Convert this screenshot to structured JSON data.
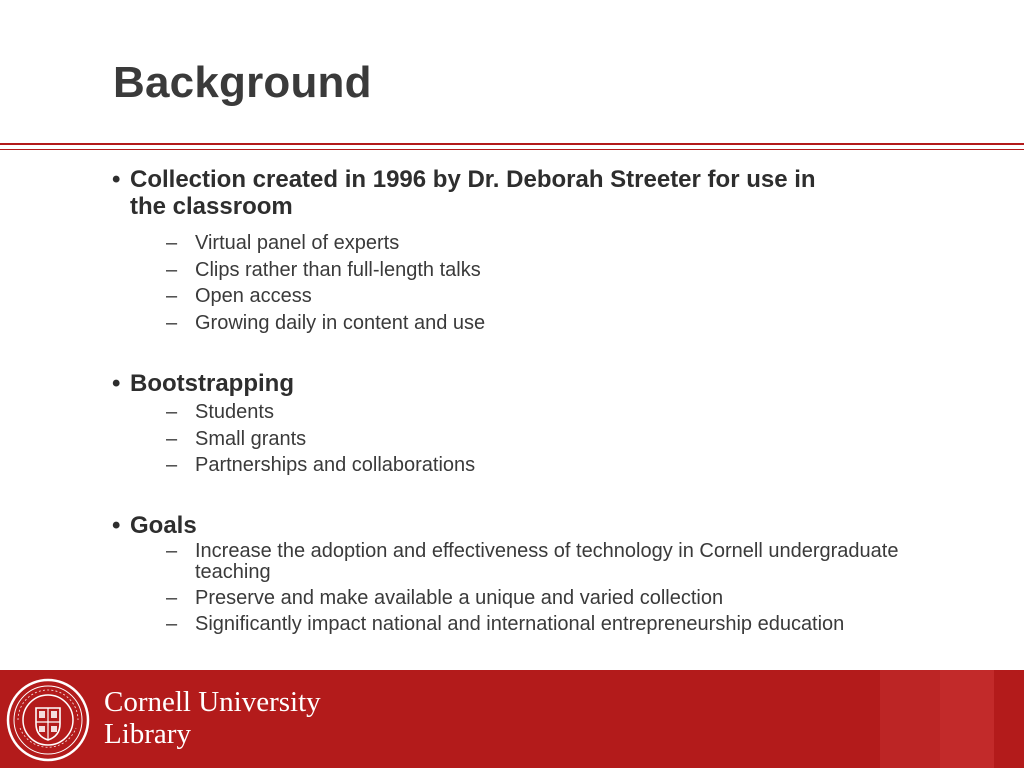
{
  "slide": {
    "title": "Background"
  },
  "bullets": [
    {
      "text_line1": "Collection created in 1996 by Dr. Deborah Streeter for use in",
      "text_line2": "the classroom",
      "subs": [
        "Virtual panel of experts",
        "Clips rather than full-length talks",
        "Open access",
        "Growing daily in content and use"
      ]
    },
    {
      "text": "Bootstrapping",
      "subs": [
        "Students",
        "Small grants",
        "Partnerships and collaborations"
      ]
    },
    {
      "text": "Goals",
      "subs": [
        {
          "line1": "Increase the adoption and effectiveness of technology in Cornell undergraduate",
          "line2": "teaching"
        },
        {
          "line1": "Preserve and make available a unique and varied collection"
        },
        {
          "line1": "Significantly impact national and international entrepreneurship education"
        }
      ]
    }
  ],
  "glyphs": {
    "bullet": "•",
    "dash": "–"
  },
  "footer": {
    "wordmark_line1": "Cornell University",
    "wordmark_line2": "Library",
    "seal_icon": "cornell-seal-icon"
  },
  "colors": {
    "brand_red": "#b31b1b",
    "title_gray": "#3a3a3a"
  }
}
